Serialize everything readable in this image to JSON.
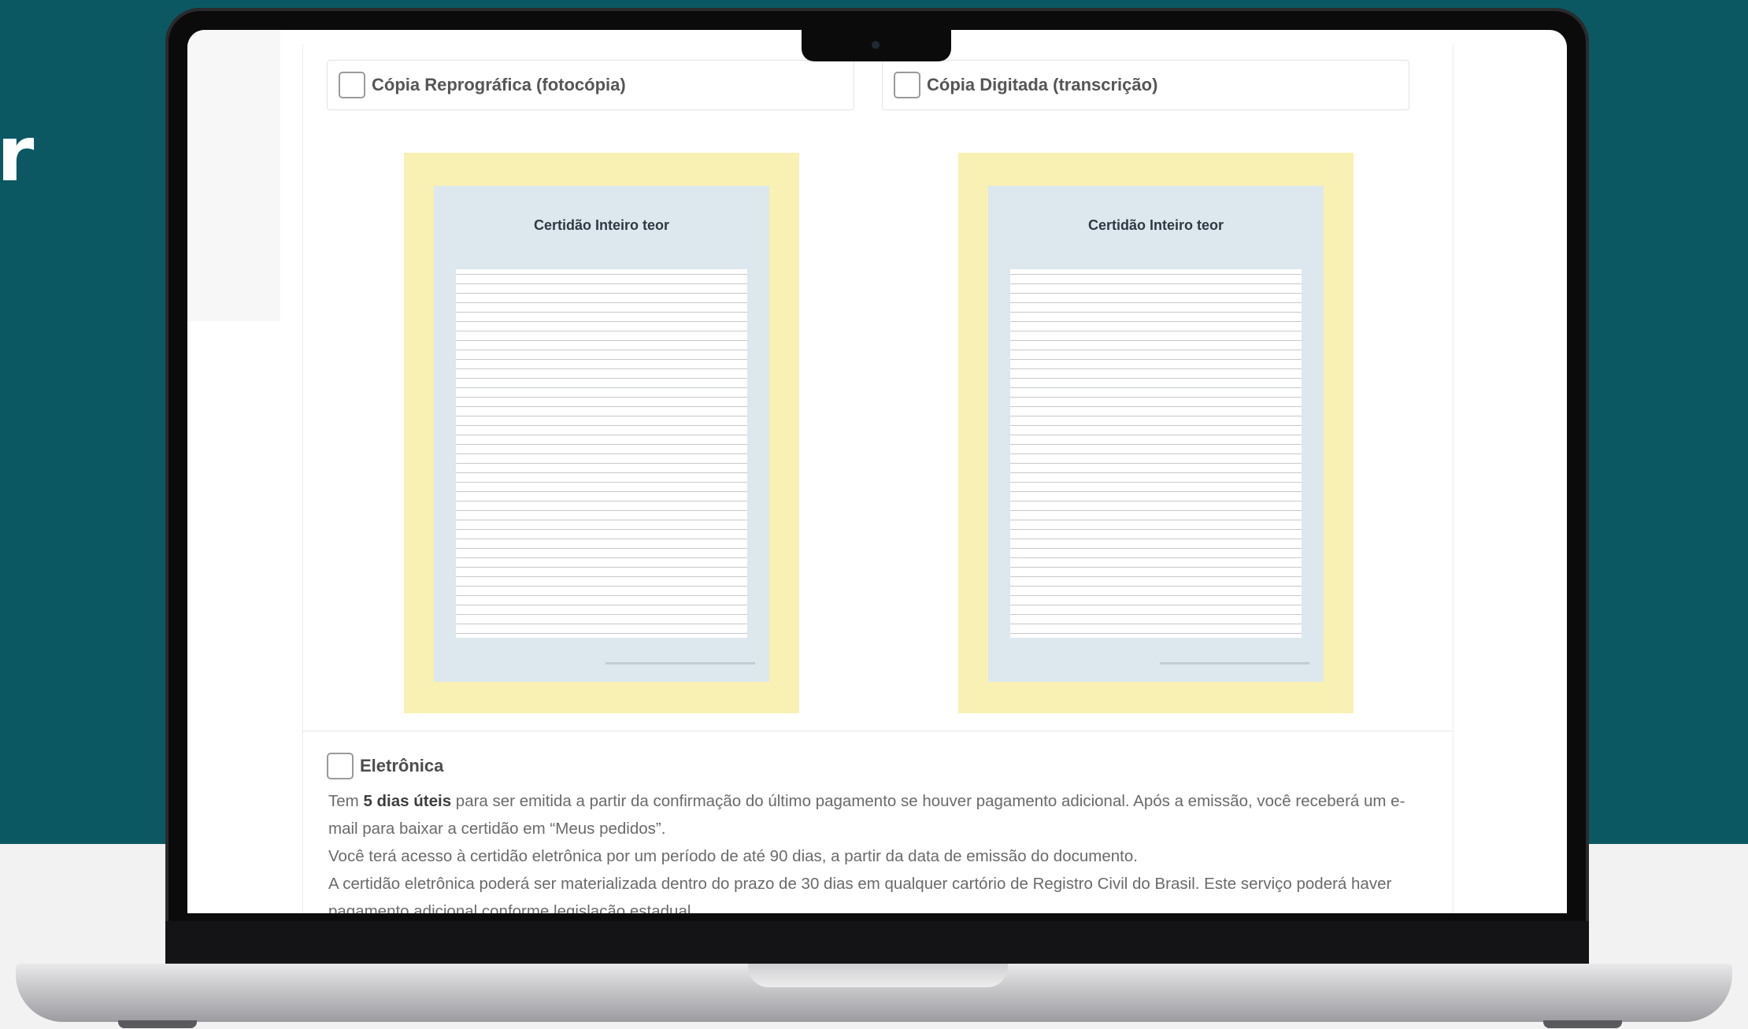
{
  "background": {
    "partial_heading": "r",
    "colors": {
      "teal": "#0b5862",
      "light": "#f2f2f2"
    }
  },
  "form": {
    "options": [
      {
        "label": "Cópia Reprográfica (fotocópia)",
        "preview_title": "Certidão Inteiro teor"
      },
      {
        "label": "Cópia Digitada (transcrição)",
        "preview_title": "Certidão Inteiro teor"
      }
    ],
    "electronic": {
      "label": "Eletrônica",
      "line1_prefix": "Tem ",
      "line1_bold": "5 dias úteis",
      "line1_rest": " para ser emitida a partir da confirmação do último pagamento se houver pagamento adicional. Após a emissão, você receberá um e-mail para baixar a certidão em “Meus pedidos”.",
      "line2": "Você terá acesso à certidão eletrônica por um período de até 90 dias, a partir da data de emissão do documento.",
      "line3": "A certidão eletrônica poderá ser materializada dentro do prazo de 30 dias em qualquer cartório de Registro Civil do Brasil. Este serviço poderá haver pagamento adicional conforme legislação estadual."
    },
    "colors": {
      "preview_frame": "#f8f1b3",
      "preview_doc": "#dde7ee"
    }
  }
}
